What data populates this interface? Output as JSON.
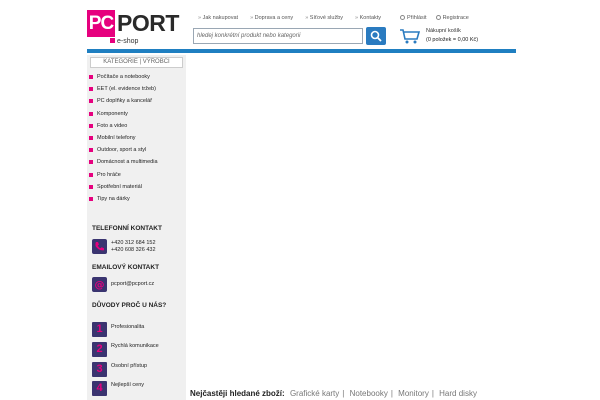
{
  "logo": {
    "pc": "PC",
    "port": "PORT",
    "eshop": "e-shop"
  },
  "topnav": {
    "items": [
      "Jak nakupovat",
      "Doprava a ceny",
      "Síťové služby",
      "Kontakty"
    ]
  },
  "auth": {
    "login": "Přihlásit",
    "register": "Registrace"
  },
  "search": {
    "placeholder": "hledej konkrétní produkt nebo kategorii"
  },
  "cart": {
    "title": "Nákupní košík",
    "summary": "(0 položek = 0,00 Kč)"
  },
  "sidebar": {
    "header": "KATEGORIE | VÝROBCI",
    "categories": [
      "Počítače a notebooky",
      "EET (el. evidence tržeb)",
      "PC doplňky a kancelář",
      "Komponenty",
      "Foto a video",
      "Mobilní telefony",
      "Outdoor, sport a styl",
      "Domácnost a multimedia",
      "Pro hráče",
      "Spotřební materiál",
      "Tipy na dárky"
    ],
    "phone_title": "TELEFONNÍ KONTAKT",
    "phone1": "+420 312 684 152",
    "phone2": "+420 608 326 432",
    "email_title": "EMAILOVÝ KONTAKT",
    "email": "pcport@pcport.cz",
    "reasons_title": "DŮVODY PROČ U NÁS?",
    "reasons": [
      {
        "num": "1",
        "text": "Profesionalita"
      },
      {
        "num": "2",
        "text": "Rychlá komunikace"
      },
      {
        "num": "3",
        "text": "Osobní přístup"
      },
      {
        "num": "4",
        "text": "Nejlepší ceny"
      }
    ]
  },
  "popular": {
    "label": "Nejčastěji hledané zboží:",
    "links": [
      "Grafické karty",
      "Notebooky",
      "Monitory",
      "Hard disky"
    ]
  },
  "colors": {
    "accent": "#e6007e",
    "brand_blue": "#1f7fc1",
    "icon_bg": "#3a3470"
  }
}
